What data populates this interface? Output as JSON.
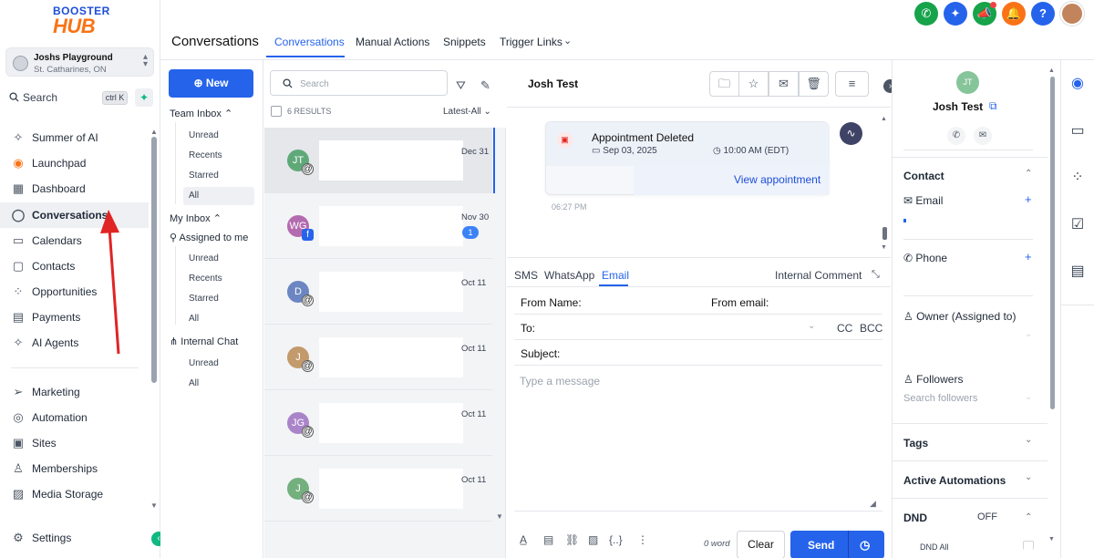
{
  "brand": {
    "logo_line1": "BOOSTER",
    "logo_line2": "HUB"
  },
  "account": {
    "name": "Joshs Playground",
    "location": "St. Catharines, ON"
  },
  "search": {
    "label": "Search",
    "shortcut": "ctrl K"
  },
  "nav": {
    "items": [
      {
        "label": "Summer of AI",
        "icon": "sparkle-icon"
      },
      {
        "label": "Launchpad",
        "icon": "rocket-icon"
      },
      {
        "label": "Dashboard",
        "icon": "grid-icon"
      },
      {
        "label": "Conversations",
        "icon": "chat-icon"
      },
      {
        "label": "Calendars",
        "icon": "calendar-icon"
      },
      {
        "label": "Contacts",
        "icon": "contacts-icon"
      },
      {
        "label": "Opportunities",
        "icon": "pipeline-icon"
      },
      {
        "label": "Payments",
        "icon": "payments-icon"
      },
      {
        "label": "AI Agents",
        "icon": "sparkle-icon"
      }
    ],
    "items2": [
      {
        "label": "Marketing",
        "icon": "send-icon"
      },
      {
        "label": "Automation",
        "icon": "automation-icon"
      },
      {
        "label": "Sites",
        "icon": "sites-icon"
      },
      {
        "label": "Memberships",
        "icon": "memberships-icon"
      },
      {
        "label": "Media Storage",
        "icon": "image-icon"
      }
    ],
    "settings": "Settings"
  },
  "header": {
    "title": "Conversations",
    "tabs": [
      "Conversations",
      "Manual Actions",
      "Snippets",
      "Trigger Links"
    ]
  },
  "inbox": {
    "new_label": "New",
    "team_inbox": "Team Inbox",
    "team_items": [
      "Unread",
      "Recents",
      "Starred",
      "All"
    ],
    "my_inbox": "My Inbox",
    "assigned": "Assigned to me",
    "my_items": [
      "Unread",
      "Recents",
      "Starred",
      "All"
    ],
    "internal_chat": "Internal Chat",
    "chat_items": [
      "Unread",
      "All"
    ]
  },
  "conv_list": {
    "search_placeholder": "Search",
    "results": "6 RESULTS",
    "filter": "Latest-All",
    "rows": [
      {
        "initials": "JT",
        "date": "Dec 31",
        "color": "#5fa979"
      },
      {
        "initials": "WG",
        "date": "Nov 30",
        "color": "#b36bb0",
        "count": "1"
      },
      {
        "initials": "D",
        "date": "Oct 11",
        "color": "#6b86c2"
      },
      {
        "initials": "J",
        "date": "Oct 11",
        "color": "#c39a6b"
      },
      {
        "initials": "JG",
        "date": "Oct 11",
        "color": "#a984c9"
      },
      {
        "initials": "J",
        "date": "Oct 11",
        "color": "#74b07e"
      }
    ]
  },
  "chat": {
    "contact_name": "Josh Test",
    "card_title": "Appointment Deleted",
    "card_date": "Sep 03, 2025",
    "card_time": "10:00 AM (EDT)",
    "card_link": "View appointment",
    "timestamp": "06:27 PM",
    "channel_tabs": [
      "SMS",
      "WhatsApp",
      "Email"
    ],
    "internal_comment": "Internal Comment",
    "from_name_label": "From Name:",
    "from_email_label": "From email:",
    "to_label": "To:",
    "cc": "CC",
    "bcc": "BCC",
    "subject_label": "Subject:",
    "message_placeholder": "Type a message",
    "word_count": "0 word",
    "clear_label": "Clear",
    "send_label": "Send"
  },
  "contact_panel": {
    "initials": "JT",
    "name": "Josh Test",
    "contact_heading": "Contact",
    "email_label": "Email",
    "phone_label": "Phone",
    "owner_label": "Owner (Assigned to)",
    "followers_label": "Followers",
    "followers_placeholder": "Search followers",
    "tags": "Tags",
    "active_automations": "Active Automations",
    "dnd": "DND",
    "dnd_state": "OFF",
    "dnd_all": "DND All"
  },
  "colors": {
    "accent": "#2563eb",
    "brand_orange": "#f97316",
    "green": "#10b981"
  }
}
